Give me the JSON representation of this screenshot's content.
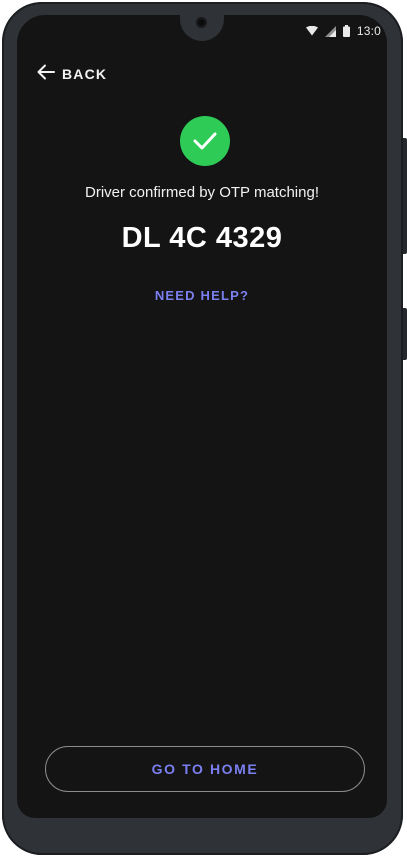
{
  "status_bar": {
    "time": "13:0",
    "icons": [
      "wifi-icon",
      "signal-icon",
      "battery-icon"
    ]
  },
  "header": {
    "back_label": "BACK",
    "back_icon": "arrow-left-icon"
  },
  "confirmation": {
    "icon": "check-circle-icon",
    "message": "Driver confirmed by OTP matching!",
    "vehicle_number": "DL 4C 4329",
    "help_link": "NEED HELP?"
  },
  "footer": {
    "home_button_label": "GO TO HOME"
  },
  "colors": {
    "background": "#141415",
    "accent": "#7b7ff0",
    "success": "#2fcb57",
    "text": "#f2f2f2"
  }
}
